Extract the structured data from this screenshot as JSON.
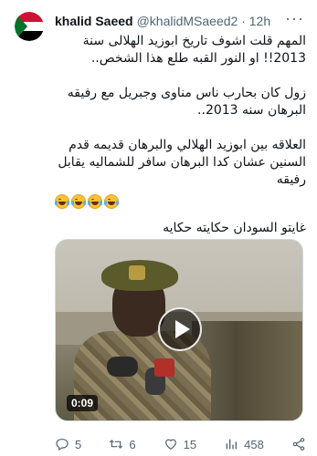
{
  "tweet": {
    "author_name": "khalid Saeed",
    "handle_time": "@khalidMSaeed2 · 12h",
    "more": "···",
    "paragraphs": [
      "المهم  قلت اشوف تاريخ  ابوزيد الهلالى  سنة 2013!! او النور القبه طلع هذا الشخص..",
      "زول كان بحارب ناس مناوى وجبريل مع رفيقه البرهان سنه 2013..",
      "العلاقه بين ابوزيد الهلالي والبرهان قديمه قدم السنين عشان كدا البرهان سافر للشماليه يقابل رفيقه",
      "غايتو السودان حكايته حكايه"
    ],
    "emoji_names": [
      "face-with-tears-of-joy",
      "face-with-tears-of-joy",
      "face-with-tears-of-joy",
      "face-with-tears-of-joy"
    ],
    "video": {
      "duration": "0:09"
    },
    "actions": {
      "replies": "5",
      "retweets": "6",
      "likes": "15",
      "views": "458"
    }
  },
  "colors": {
    "text": "#0f1419",
    "secondary": "#536471",
    "flag_red": "#d21034",
    "flag_green": "#007229",
    "flag_black": "#000000"
  }
}
